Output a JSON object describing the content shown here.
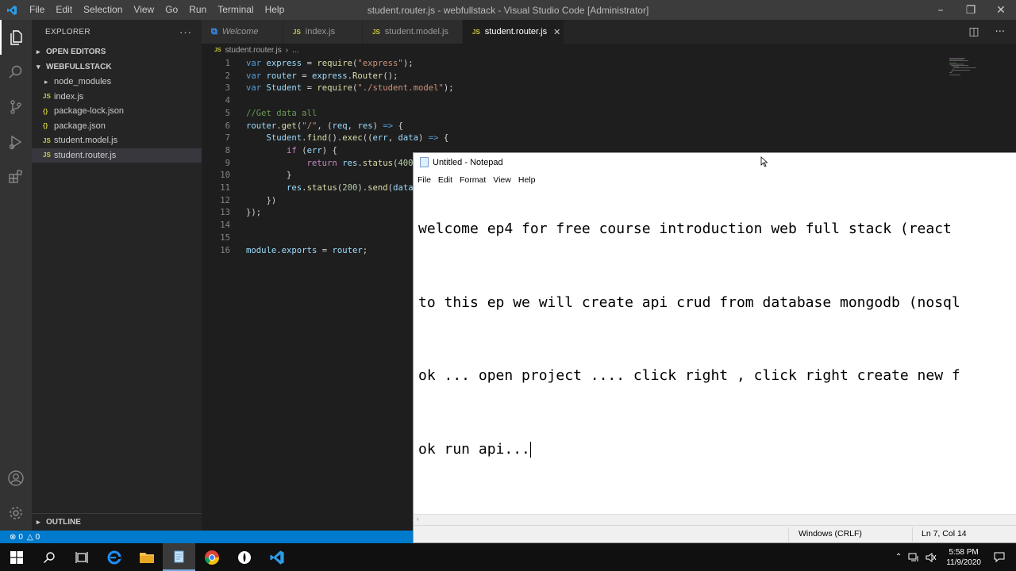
{
  "vscode": {
    "menu": [
      "File",
      "Edit",
      "Selection",
      "View",
      "Go",
      "Run",
      "Terminal",
      "Help"
    ],
    "window_title": "student.router.js - webfullstack - Visual Studio Code [Administrator]",
    "sidebar": {
      "header": "EXPLORER",
      "open_editors": "OPEN EDITORS",
      "project": "WEBFULLSTACK",
      "items": [
        {
          "label": "node_modules",
          "type": "folder"
        },
        {
          "label": "index.js",
          "type": "js"
        },
        {
          "label": "package-lock.json",
          "type": "json"
        },
        {
          "label": "package.json",
          "type": "json"
        },
        {
          "label": "student.model.js",
          "type": "js"
        },
        {
          "label": "student.router.js",
          "type": "js",
          "selected": true
        }
      ],
      "outline": "OUTLINE"
    },
    "tabs": [
      {
        "label": "Welcome",
        "icon": "vscode-icon"
      },
      {
        "label": "index.js",
        "icon": "js"
      },
      {
        "label": "student.model.js",
        "icon": "js"
      },
      {
        "label": "student.router.js",
        "icon": "js",
        "active": true
      }
    ],
    "breadcrumb": [
      "student.router.js",
      "..."
    ],
    "code": [
      {
        "n": "1",
        "text": "var express = require(\"express\");"
      },
      {
        "n": "2",
        "text": "var router = express.Router();"
      },
      {
        "n": "3",
        "text": "var Student = require(\"./student.model\");"
      },
      {
        "n": "4",
        "text": ""
      },
      {
        "n": "5",
        "text": "//Get data all"
      },
      {
        "n": "6",
        "text": "router.get(\"/\", (req, res) => {"
      },
      {
        "n": "7",
        "text": "    Student.find().exec((err, data) => {"
      },
      {
        "n": "8",
        "text": "        if (err) {"
      },
      {
        "n": "9",
        "text": "            return res.status(400"
      },
      {
        "n": "10",
        "text": "        }"
      },
      {
        "n": "11",
        "text": "        res.status(200).send(data"
      },
      {
        "n": "12",
        "text": "    })"
      },
      {
        "n": "13",
        "text": "});"
      },
      {
        "n": "14",
        "text": ""
      },
      {
        "n": "15",
        "text": ""
      },
      {
        "n": "16",
        "text": "module.exports = router;"
      }
    ],
    "status": {
      "errors": "0",
      "warnings": "0"
    }
  },
  "notepad": {
    "title": "Untitled - Notepad",
    "menu": [
      "File",
      "Edit",
      "Format",
      "View",
      "Help"
    ],
    "lines": [
      "welcome ep4 for free course introduction web full stack (react",
      "to this ep we will create api crud from database mongodb (nosql",
      "ok ... open project .... click right , click right create new f",
      "ok run api..."
    ],
    "encoding": "Windows (CRLF)",
    "position": "Ln 7, Col 14"
  },
  "taskbar": {
    "time": "5:58 PM",
    "date": "11/9/2020"
  },
  "colors": {
    "accent": "#007acc",
    "keyword": "#569cd6",
    "variable": "#9cdcfe",
    "string": "#ce9178",
    "function": "#dcdcaa",
    "comment": "#6a9955",
    "number": "#b5cea8",
    "class": "#4ec9b0"
  }
}
